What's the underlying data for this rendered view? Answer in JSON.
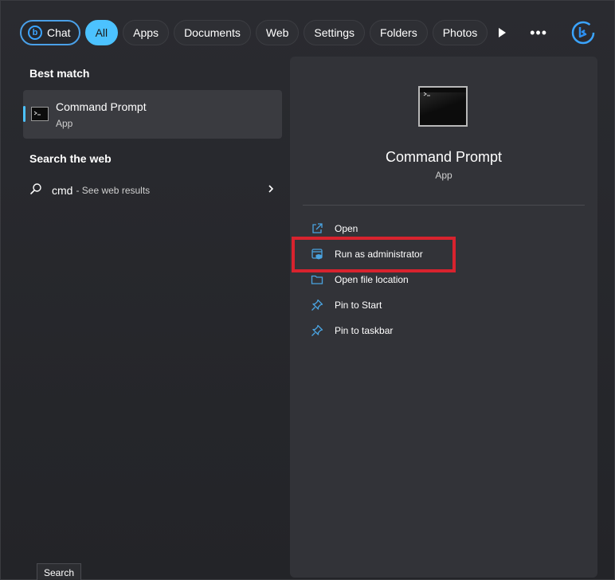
{
  "filters": {
    "chat": "Chat",
    "items": [
      "All",
      "Apps",
      "Documents",
      "Web",
      "Settings",
      "Folders",
      "Photos"
    ],
    "active": "All"
  },
  "icons": {
    "play": "play-icon",
    "more": "more-icon",
    "bing": "bing-icon"
  },
  "best_match": {
    "heading": "Best match",
    "name": "Command Prompt",
    "type": "App"
  },
  "web": {
    "heading": "Search the web",
    "query": "cmd",
    "hint": "- See web results"
  },
  "preview": {
    "title": "Command Prompt",
    "type": "App",
    "actions": [
      {
        "label": "Open",
        "icon": "open-external-icon"
      },
      {
        "label": "Run as administrator",
        "icon": "shield-admin-icon"
      },
      {
        "label": "Open file location",
        "icon": "folder-icon"
      },
      {
        "label": "Pin to Start",
        "icon": "pin-icon"
      },
      {
        "label": "Pin to taskbar",
        "icon": "pin-icon"
      }
    ],
    "highlighted_action": "Run as administrator"
  },
  "tooltip": "Search",
  "colors": {
    "accent": "#4cc2ff",
    "highlight": "#d8232e",
    "icon_blue": "#4aa3e0"
  }
}
